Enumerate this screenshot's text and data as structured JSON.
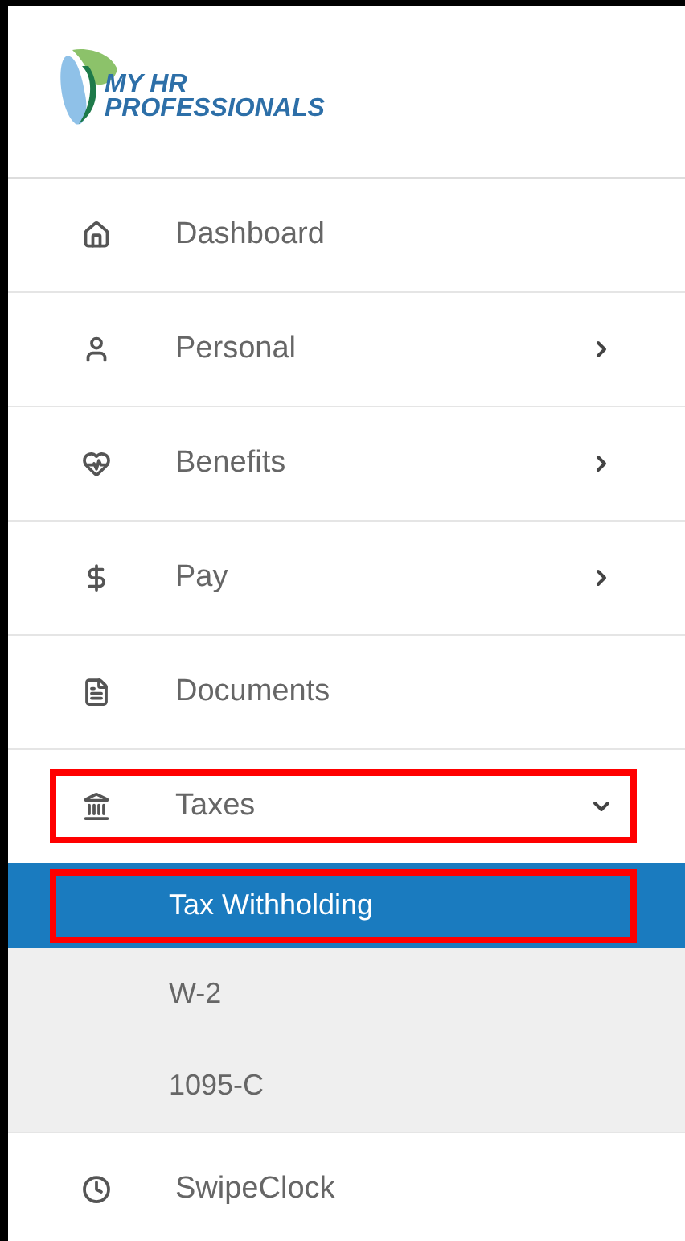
{
  "logo": {
    "line_1": "MY HR",
    "line_2": "PROFESSIONALS"
  },
  "nav": [
    {
      "label": "Dashboard",
      "kind": "link",
      "highlighted": false
    },
    {
      "label": "Personal",
      "kind": "group",
      "expanded": false,
      "highlighted": false
    },
    {
      "label": "Benefits",
      "kind": "group",
      "expanded": false,
      "highlighted": false
    },
    {
      "label": "Pay",
      "kind": "group",
      "expanded": false,
      "highlighted": false
    },
    {
      "label": "Documents",
      "kind": "link",
      "highlighted": false
    },
    {
      "label": "Taxes",
      "kind": "group",
      "expanded": true,
      "highlighted": true,
      "children": [
        {
          "label": "Tax Withholding",
          "selected": true,
          "highlighted": true
        },
        {
          "label": "W-2",
          "selected": false,
          "highlighted": false
        },
        {
          "label": "1095-C",
          "selected": false,
          "highlighted": false
        }
      ]
    },
    {
      "label": "SwipeClock",
      "kind": "link",
      "highlighted": false
    }
  ]
}
